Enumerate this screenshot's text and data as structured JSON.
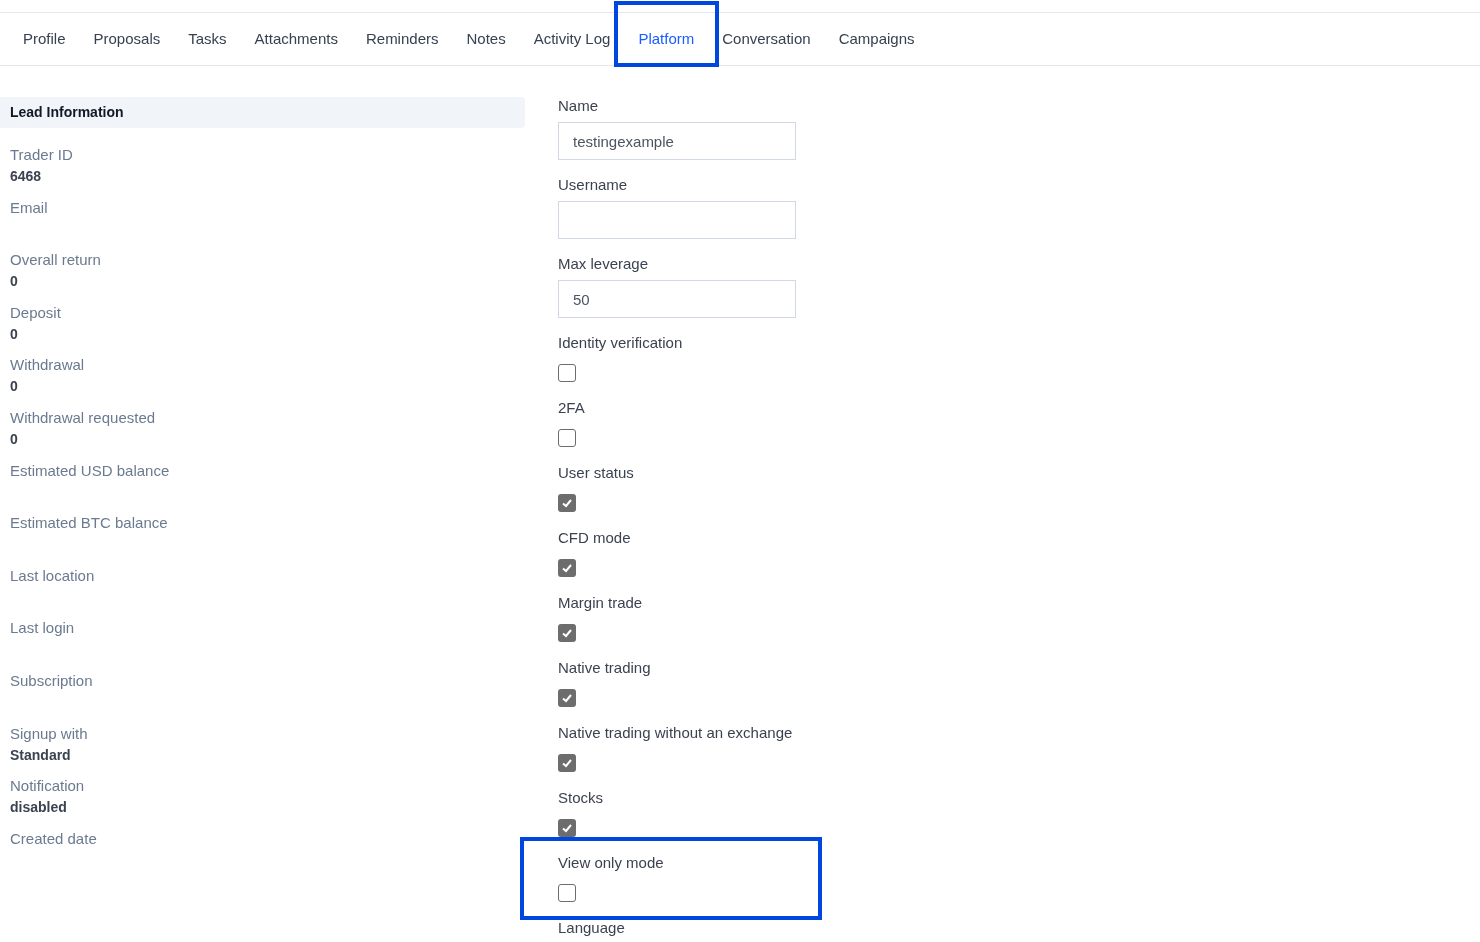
{
  "tabs": [
    {
      "label": "Profile",
      "selected": false,
      "highlighted": false
    },
    {
      "label": "Proposals",
      "selected": false,
      "highlighted": false
    },
    {
      "label": "Tasks",
      "selected": false,
      "highlighted": false
    },
    {
      "label": "Attachments",
      "selected": false,
      "highlighted": false
    },
    {
      "label": "Reminders",
      "selected": false,
      "highlighted": false
    },
    {
      "label": "Notes",
      "selected": false,
      "highlighted": false
    },
    {
      "label": "Activity Log",
      "selected": false,
      "highlighted": false
    },
    {
      "label": "Platform",
      "selected": true,
      "highlighted": true
    },
    {
      "label": "Conversation",
      "selected": false,
      "highlighted": false
    },
    {
      "label": "Campaigns",
      "selected": false,
      "highlighted": false
    }
  ],
  "lead_information": {
    "title": "Lead Information",
    "items": [
      {
        "label": "Trader ID",
        "value": "6468"
      },
      {
        "label": "Email"
      },
      {
        "label": "Overall return",
        "value": "0"
      },
      {
        "label": "Deposit",
        "value": "0"
      },
      {
        "label": "Withdrawal",
        "value": "0"
      },
      {
        "label": "Withdrawal requested",
        "value": "0"
      },
      {
        "label": "Estimated USD balance"
      },
      {
        "label": "Estimated BTC balance"
      },
      {
        "label": "Last location"
      },
      {
        "label": "Last login"
      },
      {
        "label": "Subscription"
      },
      {
        "label": "Signup with",
        "value": "Standard"
      },
      {
        "label": "Notification",
        "value": "disabled"
      },
      {
        "label": "Created date"
      }
    ]
  },
  "platform_form": [
    {
      "kind": "text",
      "label": "Name",
      "value": "testingexample",
      "highlighted": false
    },
    {
      "kind": "text",
      "label": "Username",
      "highlighted": false
    },
    {
      "kind": "text",
      "label": "Max leverage",
      "value": "50",
      "highlighted": false
    },
    {
      "kind": "checkbox",
      "label": "Identity verification",
      "checked": false,
      "highlighted": false
    },
    {
      "kind": "checkbox",
      "label": "2FA",
      "checked": false,
      "highlighted": false
    },
    {
      "kind": "checkbox",
      "label": "User status",
      "checked": true,
      "highlighted": false
    },
    {
      "kind": "checkbox",
      "label": "CFD mode",
      "checked": true,
      "highlighted": false
    },
    {
      "kind": "checkbox",
      "label": "Margin trade",
      "checked": true,
      "highlighted": false
    },
    {
      "kind": "checkbox",
      "label": "Native trading",
      "checked": true,
      "highlighted": false
    },
    {
      "kind": "checkbox",
      "label": "Native trading without an exchange",
      "checked": true,
      "highlighted": false
    },
    {
      "kind": "checkbox",
      "label": "Stocks",
      "checked": true,
      "highlighted": false
    },
    {
      "kind": "checkbox",
      "label": "View only mode",
      "checked": false,
      "highlighted": true
    },
    {
      "kind": "heading",
      "label": "Language",
      "highlighted": false
    }
  ]
}
